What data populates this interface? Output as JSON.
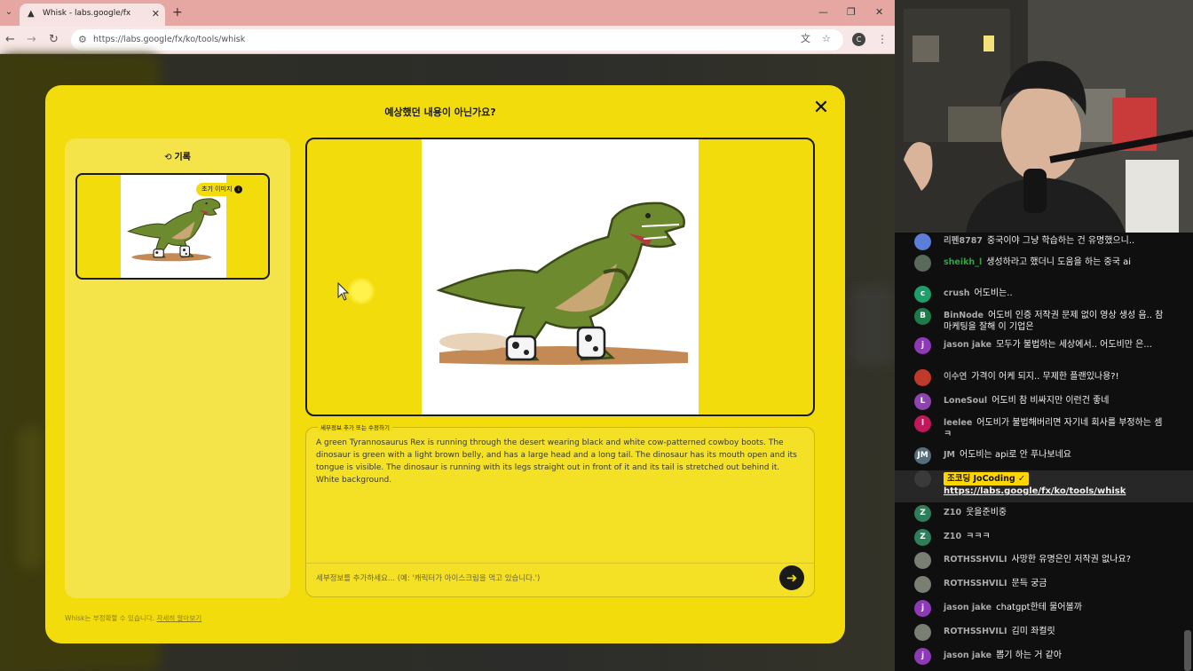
{
  "browser": {
    "tab_title": "Whisk - labs.google/fx",
    "url": "https://labs.google/fx/ko/tools/whisk",
    "profile_initial": "C"
  },
  "modal": {
    "title": "예상했던 내용이 아닌가요?",
    "history_label": "기록",
    "thumb_badge": "초기 이미지",
    "prompt_legend": "세부정보 추가 또는 수정하기",
    "prompt_text": "A green Tyrannosaurus Rex is running through the desert wearing black and white cow-patterned cowboy boots. The dinosaur is green with a light brown belly, and has a large head and a long tail. The dinosaur has its mouth open and its tongue is visible. The dinosaur is running with its legs straight out in front of it and its tail is stretched out behind it. White background.",
    "detail_placeholder": "세부정보를 추가하세요... (예: '캐릭터가 아이스크림을 먹고 있습니다.')",
    "footer_note": "Whisk는 부정확할 수 있습니다.",
    "footer_link": "자세히 알아보기"
  },
  "chat": {
    "messages": [
      {
        "author": "리펜8787",
        "text": "중국이야 그냥 학습하는 건 유명했으니..",
        "avatar_color": "#5b7fd6",
        "avatar_letter": "",
        "author_style": "gray"
      },
      {
        "author": "sheikh_l",
        "text": "생성하라고 했더니 도움을 하는 중국 ai",
        "avatar_color": "#5a6a5a",
        "avatar_letter": "",
        "author_style": "green"
      },
      {
        "author": "crush",
        "text": "어도비는..",
        "avatar_color": "#1e9e6a",
        "avatar_letter": "c",
        "author_style": "gray"
      },
      {
        "author": "BinNode",
        "text": "어도비 인증 저작권 문제 없이 영상 생성 음.. 참 마케팅을 잘해 이 기업은",
        "avatar_color": "#1f7a4a",
        "avatar_letter": "B",
        "author_style": "gray"
      },
      {
        "author": "jason jake",
        "text": "모두가 불법하는 세상에서.. 어도비만 은...",
        "avatar_color": "#8e3ab8",
        "avatar_letter": "j",
        "author_style": "gray"
      },
      {
        "author": "이수연",
        "text": "가격이 어케 되지.. 무제한 플랜있나용?!",
        "avatar_color": "#c0392b",
        "avatar_letter": "",
        "author_style": "gray"
      },
      {
        "author": "LoneSoul",
        "text": "어도비 참 비싸지만 이런건 좋네",
        "avatar_color": "#8e44ad",
        "avatar_letter": "L",
        "author_style": "gray"
      },
      {
        "author": "leelee",
        "text": "어도비가 불법해버리면 자기네 회사를 부정하는 셈 ㅋ",
        "avatar_color": "#c2185b",
        "avatar_letter": "l",
        "author_style": "gray"
      },
      {
        "author": "JM",
        "text": "어도비는 api로 안 푸나보네요",
        "avatar_color": "#546e7a",
        "avatar_letter": "JM",
        "author_style": "gray"
      },
      {
        "author": "조코딩 JoCoding ✓",
        "text": "https://labs.google/fx/ko/tools/whisk",
        "avatar_color": "#3a3a3a",
        "avatar_letter": "",
        "author_style": "owner"
      },
      {
        "author": "Z10",
        "text": "웃을준비중",
        "avatar_color": "#2e7d5b",
        "avatar_letter": "Z",
        "author_style": "gray"
      },
      {
        "author": "Z10",
        "text": "ㅋㅋㅋ",
        "avatar_color": "#2e7d5b",
        "avatar_letter": "Z",
        "author_style": "gray"
      },
      {
        "author": "ROTHSSHVILI",
        "text": "사망한 유명은인 저작권 없나요?",
        "avatar_color": "#7a7f74",
        "avatar_letter": "",
        "author_style": "gray"
      },
      {
        "author": "ROTHSSHVILI",
        "text": "문득 궁금",
        "avatar_color": "#7a7f74",
        "avatar_letter": "",
        "author_style": "gray"
      },
      {
        "author": "jason jake",
        "text": "chatgpt한테 물어볼까",
        "avatar_color": "#8e3ab8",
        "avatar_letter": "j",
        "author_style": "gray"
      },
      {
        "author": "ROTHSSHVILI",
        "text": "김미 좌컬릿",
        "avatar_color": "#7a7f74",
        "avatar_letter": "",
        "author_style": "gray"
      },
      {
        "author": "jason jake",
        "text": "뽑기 하는 거 같아",
        "avatar_color": "#8e3ab8",
        "avatar_letter": "j",
        "author_style": "gray"
      }
    ]
  }
}
